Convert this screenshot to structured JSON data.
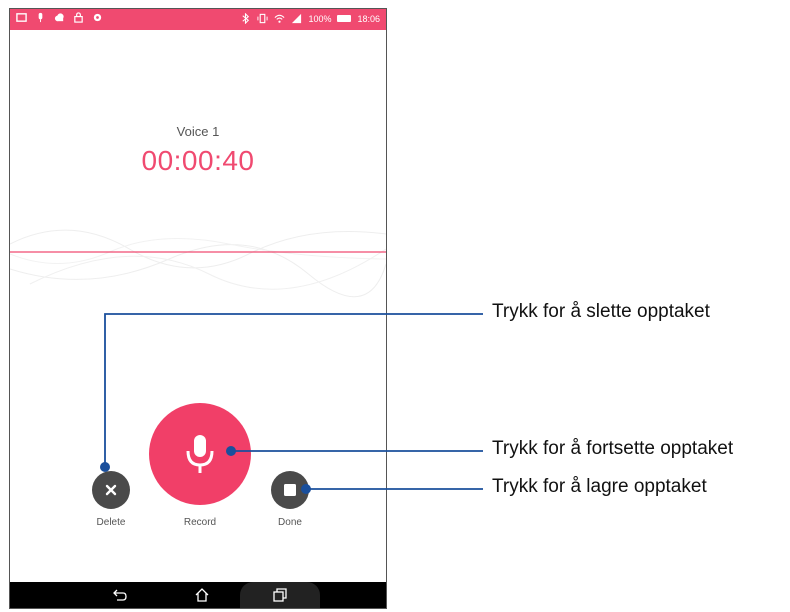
{
  "status_bar": {
    "left_icons": [
      "message-icon",
      "mic-status-icon",
      "cloud-icon",
      "lock-icon",
      "media-icon"
    ],
    "right_icons": [
      "bluetooth-icon",
      "vibrate-icon",
      "wifi-icon",
      "signal-icon"
    ],
    "battery": "100%",
    "time": "18:06"
  },
  "recording": {
    "title": "Voice 1",
    "elapsed": "00:00:40"
  },
  "controls": {
    "delete_label": "Delete",
    "record_label": "Record",
    "done_label": "Done"
  },
  "nav": {
    "icons": [
      "back-icon",
      "home-icon",
      "recent-apps-icon"
    ]
  },
  "callouts": {
    "delete": "Trykk for å slette opptaket",
    "record": "Trykk for å fortsette opptaket",
    "done": "Trykk for å lagre opptaket"
  },
  "colors": {
    "accent": "#f04a70",
    "callout_line": "#1a4f9c",
    "control_dark": "#4a4a4a"
  }
}
